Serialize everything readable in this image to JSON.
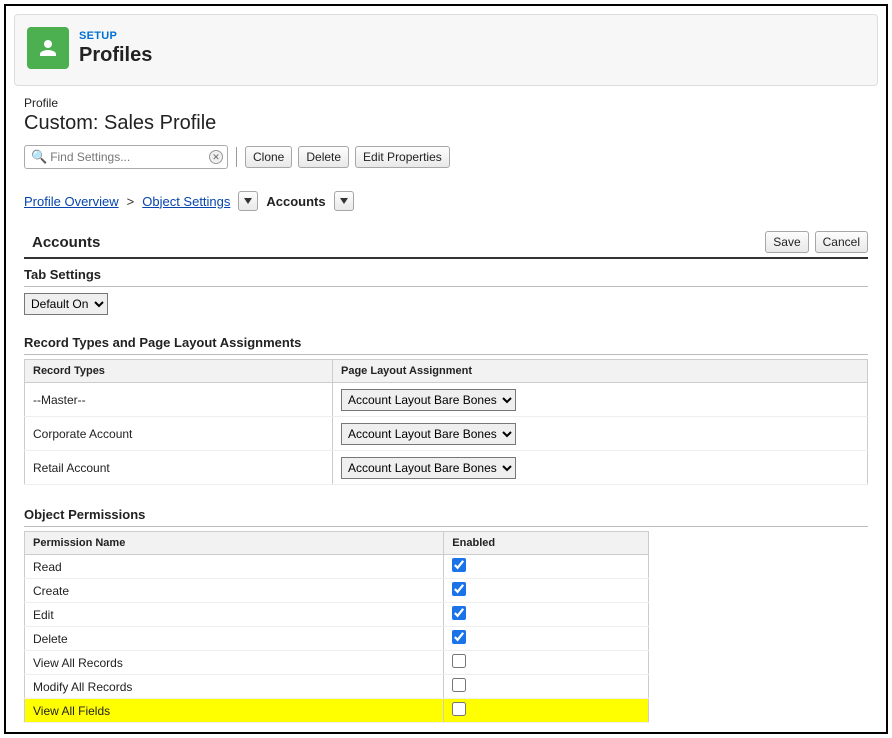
{
  "header": {
    "setup_label": "SETUP",
    "title": "Profiles"
  },
  "profile": {
    "sub_label": "Profile",
    "name": "Custom: Sales Profile"
  },
  "search": {
    "placeholder": "Find Settings..."
  },
  "toolbar": {
    "clone": "Clone",
    "delete": "Delete",
    "edit_properties": "Edit Properties"
  },
  "breadcrumb": {
    "profile_overview": "Profile Overview",
    "object_settings": "Object Settings",
    "current": "Accounts"
  },
  "section": {
    "title": "Accounts",
    "save": "Save",
    "cancel": "Cancel"
  },
  "tab_settings": {
    "title": "Tab Settings",
    "selected": "Default On"
  },
  "record_types": {
    "title": "Record Types and Page Layout Assignments",
    "col_record_types": "Record Types",
    "col_layout": "Page Layout Assignment",
    "rows": [
      {
        "name": "--Master--",
        "layout": "Account Layout Bare Bones"
      },
      {
        "name": "Corporate Account",
        "layout": "Account Layout Bare Bones"
      },
      {
        "name": "Retail Account",
        "layout": "Account Layout Bare Bones"
      }
    ]
  },
  "object_permissions": {
    "title": "Object Permissions",
    "col_name": "Permission Name",
    "col_enabled": "Enabled",
    "rows": [
      {
        "name": "Read",
        "enabled": true,
        "highlight": false
      },
      {
        "name": "Create",
        "enabled": true,
        "highlight": false
      },
      {
        "name": "Edit",
        "enabled": true,
        "highlight": false
      },
      {
        "name": "Delete",
        "enabled": true,
        "highlight": false
      },
      {
        "name": "View All Records",
        "enabled": false,
        "highlight": false
      },
      {
        "name": "Modify All Records",
        "enabled": false,
        "highlight": false
      },
      {
        "name": "View All Fields",
        "enabled": false,
        "highlight": true
      }
    ]
  }
}
